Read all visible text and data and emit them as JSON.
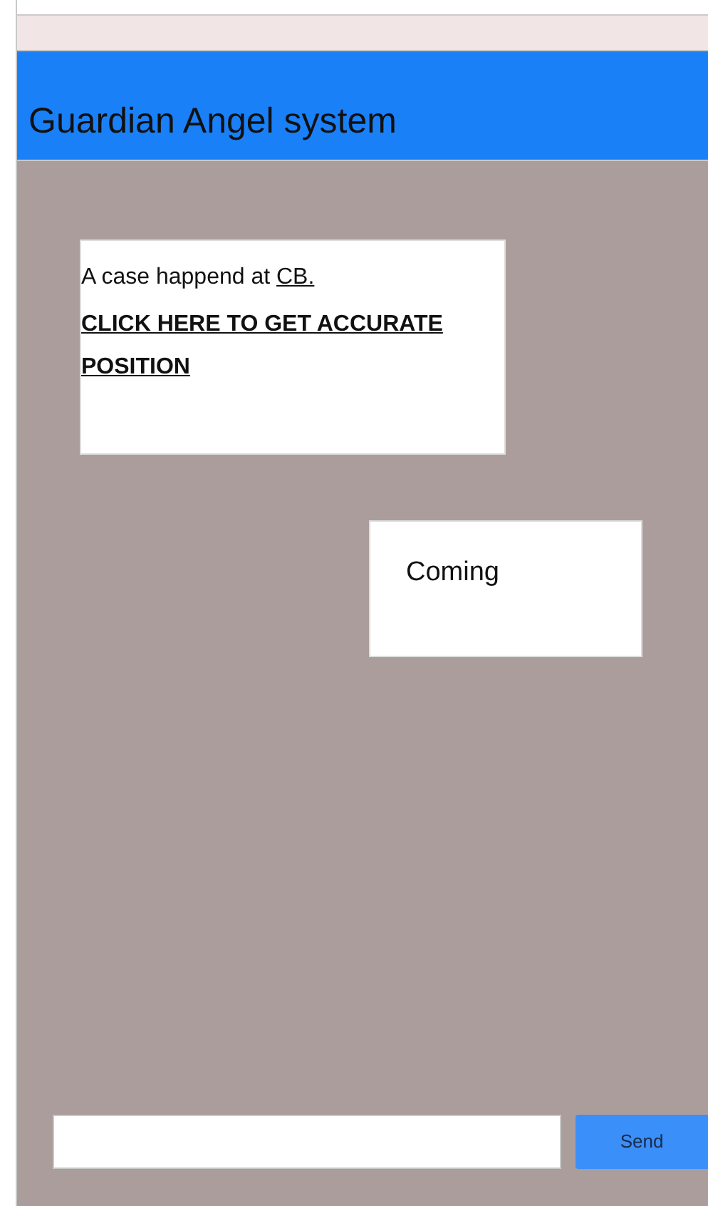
{
  "header": {
    "title": "Guardian Angel system"
  },
  "messages": [
    {
      "kind": "alert",
      "text": "A case happend at ",
      "place_link": "CB.",
      "action_link": "CLICK HERE TO GET ACCURATE POSITION"
    },
    {
      "kind": "reply",
      "text": "Coming"
    }
  ],
  "composer": {
    "button": "Send"
  }
}
